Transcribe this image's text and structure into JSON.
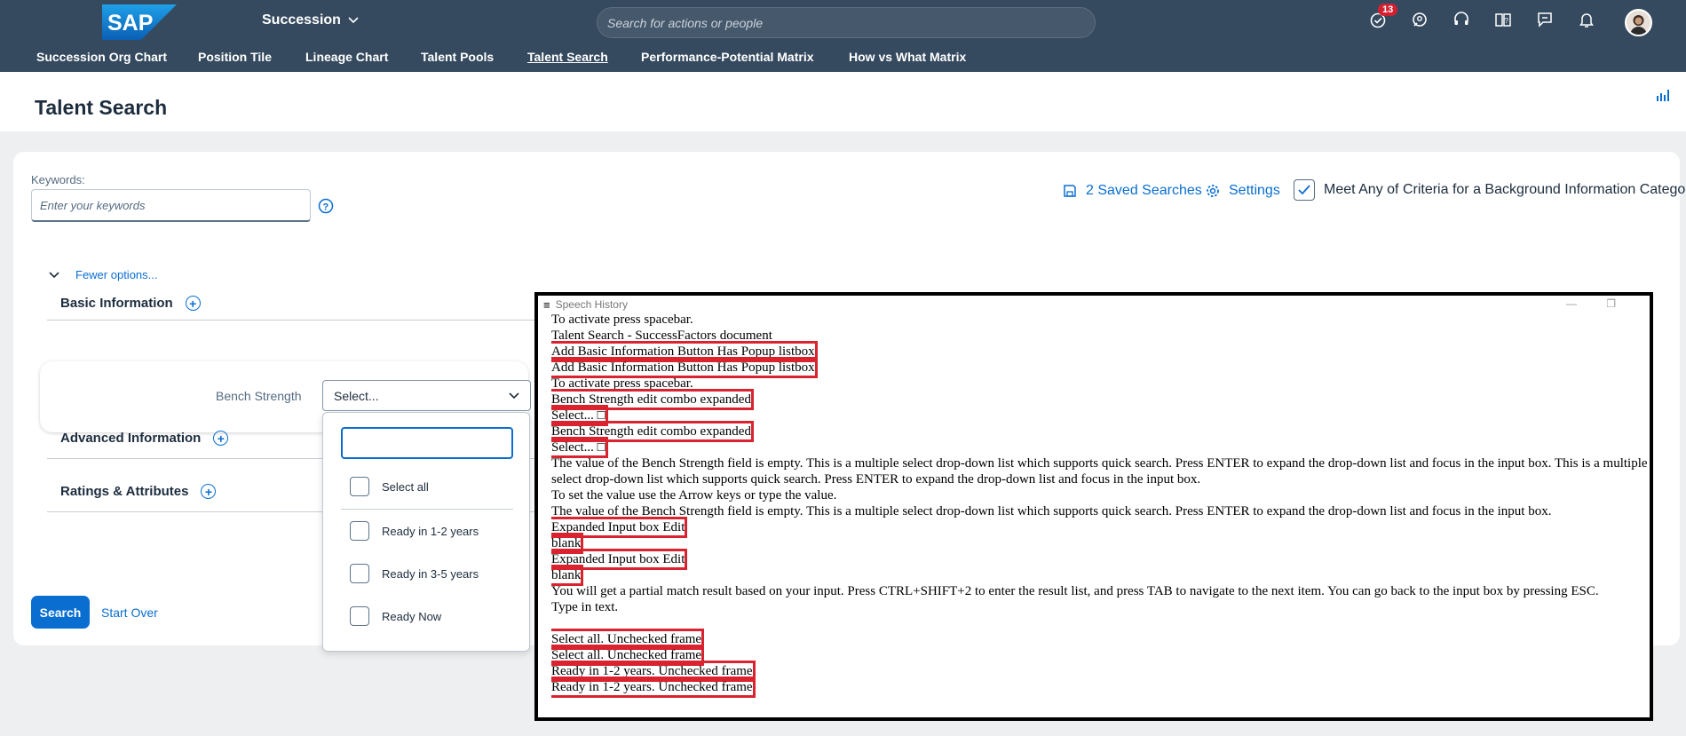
{
  "shell": {
    "logo_text": "SAP",
    "app_title": "Succession",
    "search_placeholder": "Search for actions or people",
    "notification_count": "13",
    "icons": [
      "todo-icon",
      "chat-icon",
      "headset-icon",
      "help-book-icon",
      "feedback-icon",
      "bell-icon"
    ]
  },
  "nav": {
    "items": [
      "Succession Org Chart",
      "Position Tile",
      "Lineage Chart",
      "Talent Pools",
      "Talent Search",
      "Performance-Potential Matrix",
      "How vs What Matrix"
    ],
    "active": "Talent Search"
  },
  "page": {
    "title": "Talent Search"
  },
  "form": {
    "keywords_label": "Keywords:",
    "keywords_placeholder": "Enter your keywords",
    "saved_searches": "2 Saved Searches",
    "settings": "Settings",
    "meet_any": "Meet Any of Criteria for a Background Information Category",
    "fewer_options": "Fewer options...",
    "sections": [
      "Basic Information",
      "Advanced Information",
      "Ratings & Attributes"
    ],
    "bench_label": "Bench Strength",
    "bench_value": "Select...",
    "search_btn": "Search",
    "start_over": "Start Over"
  },
  "dropdown": {
    "search_value": "",
    "select_all": "Select all",
    "options": [
      "Ready in 1-2 years",
      "Ready in 3-5 years",
      "Ready Now"
    ]
  },
  "speech_history": {
    "title": "Speech History",
    "lines": [
      {
        "text": "To activate press spacebar.",
        "hl": false
      },
      {
        "text": "Talent Search - SuccessFactors document",
        "hl": false
      },
      {
        "text": "Add Basic Information Button Has Popup listbox",
        "hl": true
      },
      {
        "text": "Add Basic Information Button Has Popup listbox",
        "hl": true
      },
      {
        "text": "To activate press spacebar.",
        "hl": false
      },
      {
        "text": "Bench Strength edit combo expanded",
        "hl": true
      },
      {
        "text": "Select... □",
        "hl": true
      },
      {
        "text": "Bench Strength edit combo expanded",
        "hl": true
      },
      {
        "text": "Select... □",
        "hl": true
      },
      {
        "text": "The value of the Bench Strength field is empty. This is a multiple select drop-down list which supports quick search. Press ENTER to expand the drop-down list and focus in the input box. This is a multiple select drop-down list which supports quick search. Press ENTER to expand the drop-down list and focus in the input box.",
        "hl": false
      },
      {
        "text": "To set the value use the Arrow keys or type the value.",
        "hl": false
      },
      {
        "text": "The value of the Bench Strength field is empty. This is a multiple select drop-down list which supports quick search. Press ENTER to expand the drop-down list and focus in the input box.",
        "hl": false
      },
      {
        "text": "Expanded Input box Edit",
        "hl": true
      },
      {
        "text": "blank",
        "hl": true
      },
      {
        "text": "Expanded Input box Edit",
        "hl": true
      },
      {
        "text": "blank",
        "hl": true
      },
      {
        "text": "You will get a partial match result based on your input. Press CTRL+SHIFT+2 to enter the result list, and press TAB to navigate to the next item. You can go back to the input box by pressing ESC.",
        "hl": false
      },
      {
        "text": "Type in text.",
        "hl": false
      },
      {
        "text": "",
        "hl": false
      },
      {
        "text": "Select all. Unchecked frame",
        "hl": true
      },
      {
        "text": "Select all. Unchecked frame",
        "hl": true
      },
      {
        "text": "Ready in 1-2 years. Unchecked frame",
        "hl": true
      },
      {
        "text": "Ready in 1-2 years. Unchecked frame",
        "hl": true
      }
    ]
  }
}
